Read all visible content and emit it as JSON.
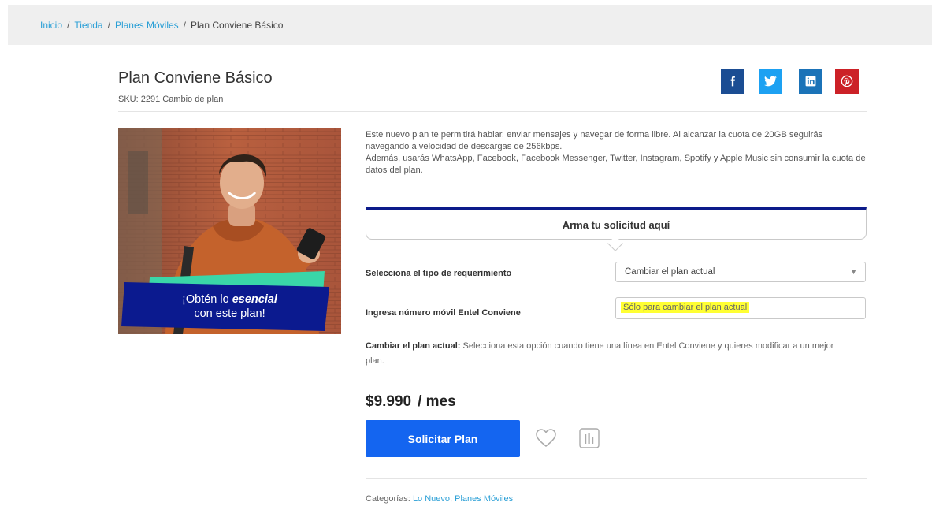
{
  "breadcrumb": {
    "items": [
      "Inicio",
      "Tienda",
      "Planes Móviles"
    ],
    "current": "Plan Conviene Básico",
    "separator": "/"
  },
  "product": {
    "title": "Plan Conviene Básico",
    "sku": "SKU: 2291 Cambio de plan",
    "description": [
      "Este nuevo plan te permitirá hablar, enviar mensajes y navegar de forma libre. Al alcanzar la cuota de 20GB seguirás navegando a velocidad de descargas de 256kbps.",
      "Además, usarás WhatsApp, Facebook, Facebook Messenger, Twitter, Instagram, Spotify y Apple Music sin consumir la cuota de datos del plan."
    ],
    "banner_line1_prefix": "¡Obtén lo ",
    "banner_line1_emph": "esencial",
    "banner_line2": "con este plan!"
  },
  "social": {
    "facebook": "facebook-icon",
    "twitter": "twitter-icon",
    "linkedin": "linkedin-icon",
    "pinterest": "pinterest-icon"
  },
  "form": {
    "heading": "Arma tu solicitud aquí",
    "type_label": "Selecciona el tipo de requerimiento",
    "type_selected": "Cambiar el plan actual",
    "number_label": "Ingresa número móvil Entel Conviene",
    "number_placeholder": "Sólo para cambiar el plan actual",
    "help_title": "Cambiar el plan actual:",
    "help_text": " Selecciona esta opción cuando tiene una línea en Entel Conviene y quieres modificar a un mejor plan."
  },
  "pricing": {
    "amount": "$9.990",
    "period": "/ mes",
    "cta": "Solicitar Plan"
  },
  "categories": {
    "label": "Categorías:",
    "items": [
      "Lo Nuevo",
      "Planes Móviles"
    ]
  },
  "colors": {
    "cta": "#1465f0",
    "accent_bar": "#0c1b8a",
    "link": "#2a9fd6",
    "facebook": "#1b4d93",
    "twitter": "#1da1f2",
    "linkedin": "#1b73b8",
    "pinterest": "#cc2127",
    "highlight": "#ffff33"
  }
}
